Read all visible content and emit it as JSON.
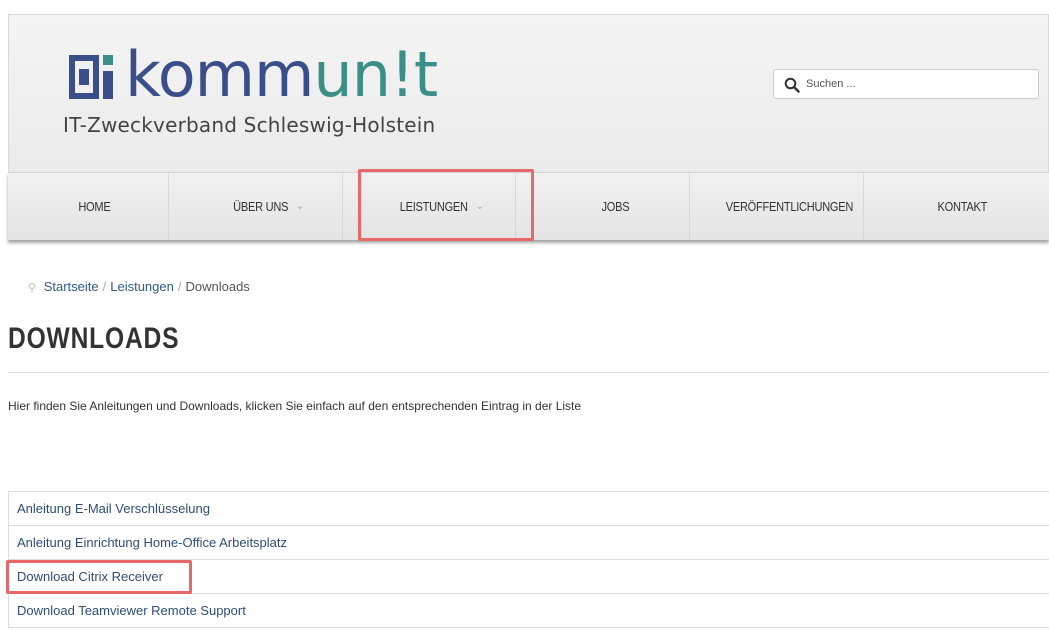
{
  "brand": {
    "word_a": "komm",
    "word_b": "un",
    "word_c": "!t",
    "subtitle": "IT-Zweckverband Schleswig-Holstein",
    "colors": {
      "primary": "#3a4f8a",
      "accent": "#3c8f86"
    }
  },
  "search": {
    "placeholder": "Suchen ...",
    "icon": "search-icon"
  },
  "nav": {
    "items": [
      {
        "label": "HOME",
        "chevron": ""
      },
      {
        "label": "ÜBER UNS",
        "chevron": "⌄"
      },
      {
        "label": "LEISTUNGEN",
        "chevron": "⌄"
      },
      {
        "label": "JOBS",
        "chevron": ""
      },
      {
        "label": "VERÖFFENTLICHUNGEN",
        "chevron": ""
      },
      {
        "label": "KONTAKT",
        "chevron": ""
      }
    ]
  },
  "breadcrumb": {
    "items": [
      "Startseite",
      "Leistungen",
      "Downloads"
    ],
    "separator": "/"
  },
  "page": {
    "title": "DOWNLOADS",
    "intro": "Hier finden Sie Anleitungen und Downloads, klicken Sie einfach auf den entsprechenden Eintrag in der Liste"
  },
  "downloads": [
    "Anleitung E-Mail Verschlüsselung",
    "Anleitung Einrichtung Home-Office Arbeitsplatz",
    "Download Citrix Receiver",
    "Download Teamviewer Remote Support"
  ],
  "highlight_color": "#e8686a"
}
